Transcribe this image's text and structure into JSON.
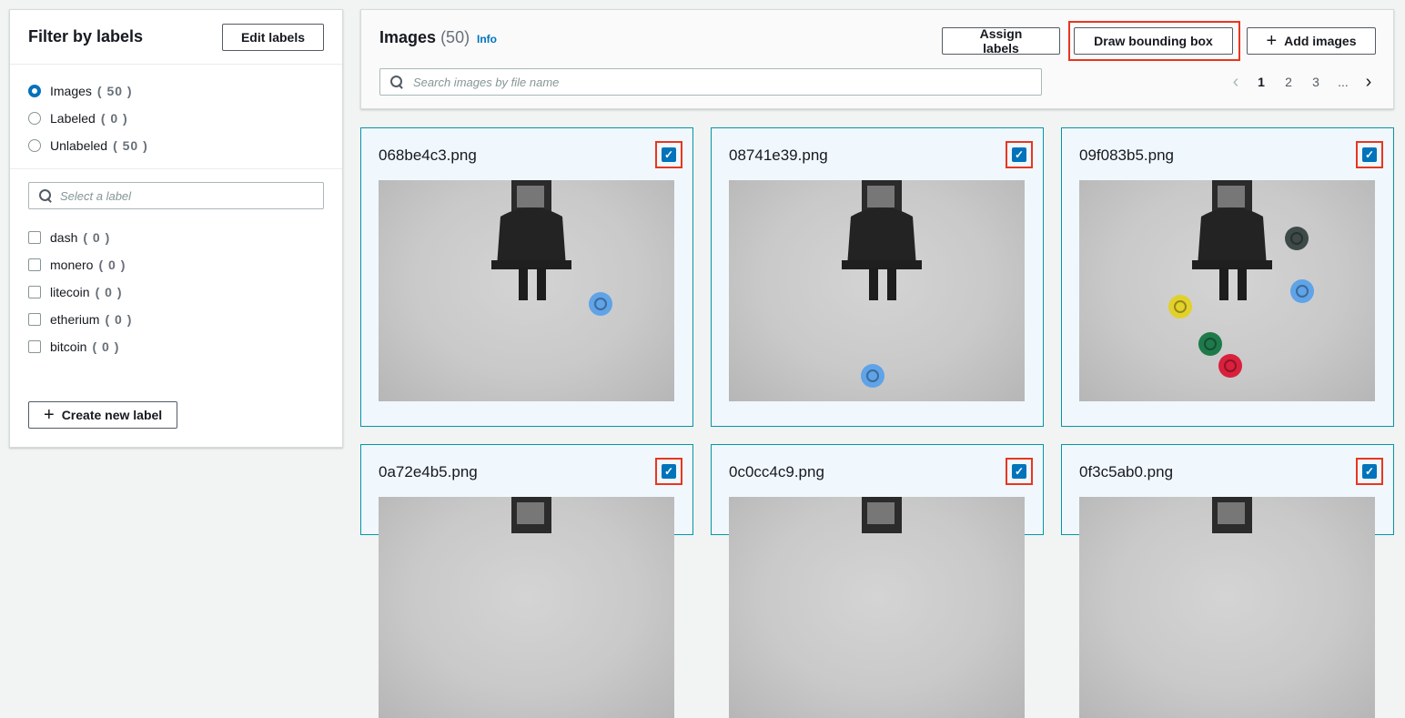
{
  "filter": {
    "title": "Filter by labels",
    "edit_label": "Edit labels",
    "views": [
      {
        "name": "Images",
        "count": "( 50 )",
        "selected": true
      },
      {
        "name": "Labeled",
        "count": "( 0 )",
        "selected": false
      },
      {
        "name": "Unlabeled",
        "count": "( 50 )",
        "selected": false
      }
    ],
    "label_search_placeholder": "Select a label",
    "labels": [
      {
        "name": "dash",
        "count": "( 0 )"
      },
      {
        "name": "monero",
        "count": "( 0 )"
      },
      {
        "name": "litecoin",
        "count": "( 0 )"
      },
      {
        "name": "etherium",
        "count": "( 0 )"
      },
      {
        "name": "bitcoin",
        "count": "( 0 )"
      }
    ],
    "create_label": "Create new label"
  },
  "images": {
    "title": "Images",
    "count": "(50)",
    "info": "Info",
    "assign_label": "Assign labels",
    "draw_label": "Draw bounding box",
    "add_label": "Add images",
    "search_placeholder": "Search images by file name",
    "pages": [
      "1",
      "2",
      "3",
      "..."
    ],
    "current_page": "1"
  },
  "cards": [
    {
      "file": "068be4c3.png",
      "checked": true
    },
    {
      "file": "08741e39.png",
      "checked": true
    },
    {
      "file": "09f083b5.png",
      "checked": true
    },
    {
      "file": "0a72e4b5.png",
      "checked": true
    },
    {
      "file": "0c0cc4c9.png",
      "checked": true
    },
    {
      "file": "0f3c5ab0.png",
      "checked": true
    }
  ],
  "colors": {
    "accent": "#0073bb",
    "highlight": "#e8361f",
    "card_border": "#0097a7",
    "card_bg": "#f1f8fd"
  }
}
